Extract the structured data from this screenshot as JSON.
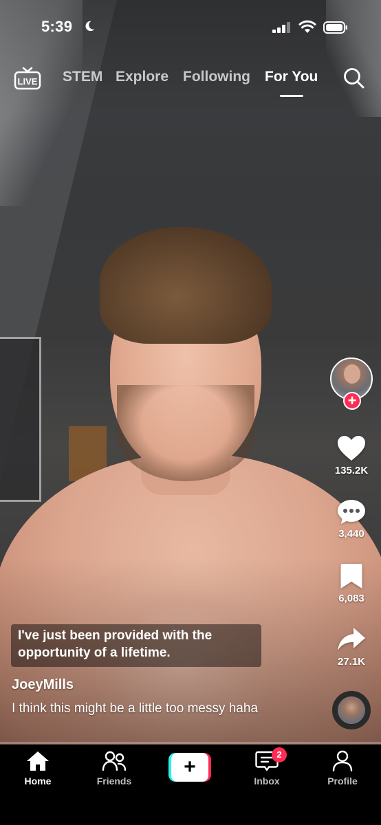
{
  "status_bar": {
    "time": "5:39",
    "icons": [
      "moon-icon",
      "cellular-signal-icon",
      "wifi-icon",
      "battery-icon"
    ]
  },
  "top_nav": {
    "live_label": "LIVE",
    "tabs": [
      {
        "label": "STEM",
        "active": false
      },
      {
        "label": "Explore",
        "active": false
      },
      {
        "label": "Following",
        "active": false
      },
      {
        "label": "For You",
        "active": true
      }
    ],
    "search_icon": "search-icon"
  },
  "actions": {
    "follow_symbol": "+",
    "likes": "135.2K",
    "comments": "3,440",
    "saves": "6,083",
    "shares": "27.1K",
    "icons": [
      "heart-icon",
      "comment-icon",
      "bookmark-icon",
      "share-icon"
    ]
  },
  "video": {
    "caption_overlay": "I've just been provided with the opportunity of a lifetime.",
    "username": "JoeyMills",
    "description": "I think this might be a little too messy haha"
  },
  "bottom_nav": {
    "items": [
      {
        "label": "Home",
        "icon": "home-icon",
        "active": true
      },
      {
        "label": "Friends",
        "icon": "friends-icon",
        "active": false
      },
      {
        "label": "",
        "icon": "create-icon",
        "active": false
      },
      {
        "label": "Inbox",
        "icon": "inbox-icon",
        "active": false,
        "badge": "2"
      },
      {
        "label": "Profile",
        "icon": "profile-icon",
        "active": false
      }
    ]
  },
  "colors": {
    "accent_red": "#fe2c55",
    "accent_cyan": "#25f4ee",
    "background": "#000000"
  }
}
